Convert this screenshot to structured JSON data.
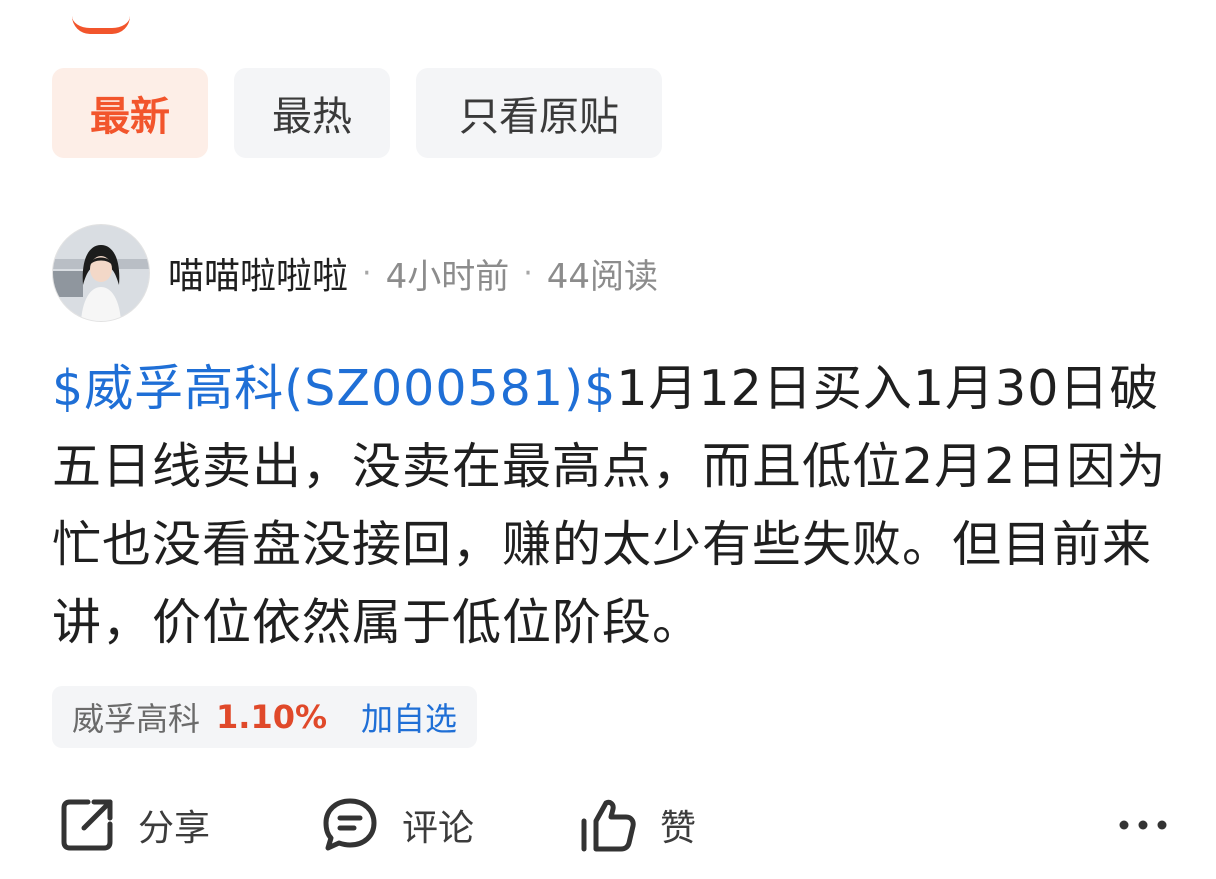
{
  "tabs": [
    {
      "label": "最新",
      "active": true
    },
    {
      "label": "最热",
      "active": false
    },
    {
      "label": "只看原贴",
      "active": false
    }
  ],
  "post": {
    "author": "喵喵啦啦啦",
    "separator": "·",
    "time": "4小时前",
    "reads": "44阅读",
    "stock_link": "$威孚高科(SZ000581)$",
    "content": "1月12日买入1月30日破五日线卖出，没卖在最高点，而且低位2月2日因为忙也没看盘没接回，赚的太少有些失败。但目前来讲，价位依然属于低位阶段。"
  },
  "stock_chip": {
    "name": "威孚高科",
    "change": "1.10%",
    "add_label": "加自选"
  },
  "actions": {
    "share": "分享",
    "comment": "评论",
    "like": "赞",
    "more": "•••"
  },
  "colors": {
    "accent": "#f2552c",
    "link": "#1f6fd6",
    "up": "#e0492a"
  }
}
